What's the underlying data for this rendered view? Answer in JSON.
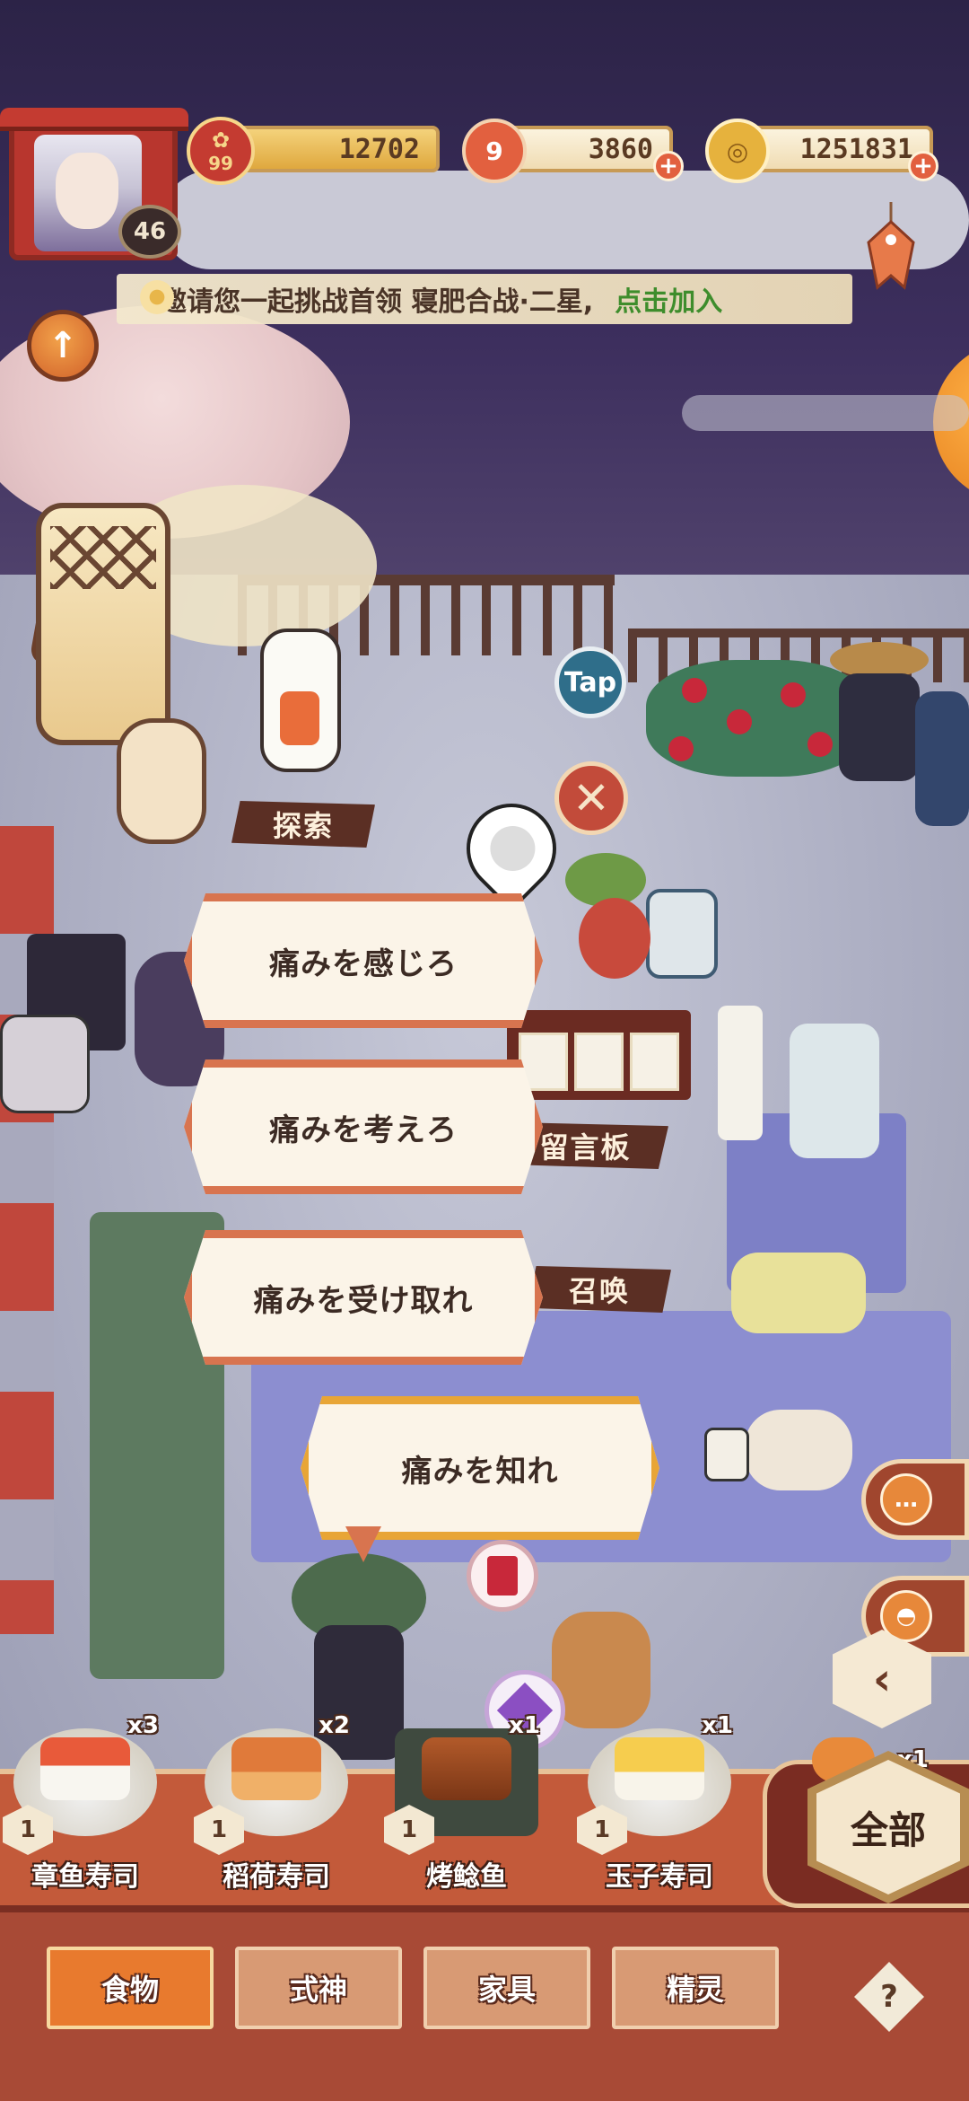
{
  "hud": {
    "player_level": "46",
    "stamina_tier": "99",
    "currency_a": "12702",
    "currency_b": "3860",
    "currency_b_icon_text": "9",
    "gold": "1251831",
    "plus_symbol": "+"
  },
  "banner": {
    "text": "邀请您一起挑战首领 寝肥合战·二星,",
    "link_text": "点击加入"
  },
  "scene_labels": {
    "explore": "探索",
    "message_board": "留言板",
    "summon": "召唤",
    "tap_badge": "Tap"
  },
  "dialogue": {
    "choices": [
      "痛みを感じろ",
      "痛みを考えろ",
      "痛みを受け取れ",
      "痛みを知れ"
    ]
  },
  "food_tray": {
    "items": [
      {
        "name": "章鱼寿司",
        "count": "x3",
        "level": "1"
      },
      {
        "name": "稻荷寿司",
        "count": "x2",
        "level": "1"
      },
      {
        "name": "烤鲶鱼",
        "count": "x1",
        "level": "1"
      },
      {
        "name": "玉子寿司",
        "count": "x1",
        "level": "1"
      }
    ],
    "extra_count": "x1",
    "all_label": "全部"
  },
  "tabs": [
    {
      "label": "食物",
      "active": true
    },
    {
      "label": "式神",
      "active": false
    },
    {
      "label": "家具",
      "active": false
    },
    {
      "label": "精灵",
      "active": false
    }
  ],
  "help_label": "?",
  "colors": {
    "accent_orange": "#e87a2e",
    "choice_border": "#d8744f",
    "primary_choice_border": "#e8a536",
    "bar_red": "#a84a36",
    "highlight_green": "#3e8d2c"
  }
}
